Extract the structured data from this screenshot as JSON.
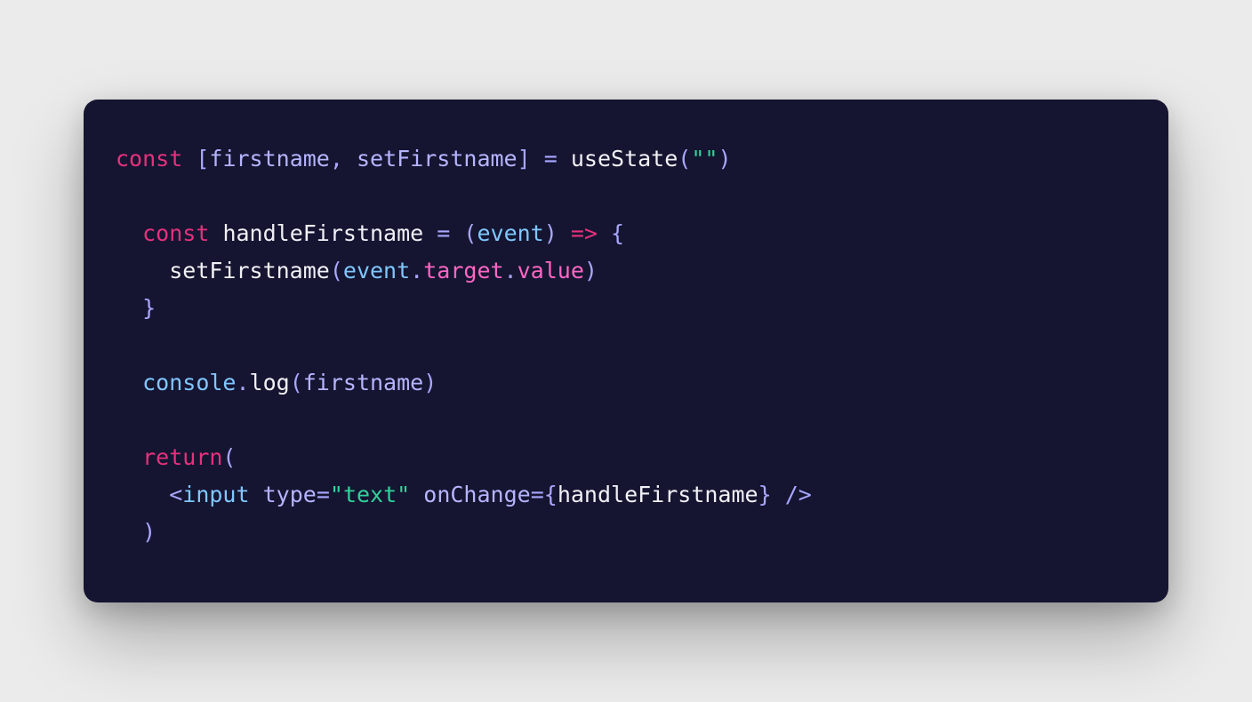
{
  "code": {
    "l1": {
      "kw": "const",
      "lb": "[",
      "v1": "firstname",
      "comma": ",",
      "v2": "setFirstname",
      "rb": "]",
      "eq": "=",
      "fn": "useState",
      "lp": "(",
      "q1": "\"\"",
      "rp": ")"
    },
    "l3": {
      "kw": "const",
      "name": "handleFirstname",
      "eq": "=",
      "lp": "(",
      "param": "event",
      "rp": ")",
      "arrow": "=>",
      "lb": "{"
    },
    "l4": {
      "fn": "setFirstname",
      "lp": "(",
      "obj": "event",
      "dot1": ".",
      "p1": "target",
      "dot2": ".",
      "p2": "value",
      "rp": ")"
    },
    "l5": {
      "rb": "}"
    },
    "l7": {
      "obj": "console",
      "dot": ".",
      "fn": "log",
      "lp": "(",
      "arg": "firstname",
      "rp": ")"
    },
    "l9": {
      "kw": "return",
      "lp": "("
    },
    "l10": {
      "lt": "<",
      "tag": "input",
      "a1": "type",
      "eq1": "=",
      "s1": "\"text\"",
      "a2": "onChange",
      "eq2": "=",
      "lc": "{",
      "h": "handleFirstname",
      "rc": "}",
      "end": " />"
    },
    "l11": {
      "rp": ")"
    },
    "indent1": "  ",
    "indent2": "    ",
    "indent3": "      "
  }
}
